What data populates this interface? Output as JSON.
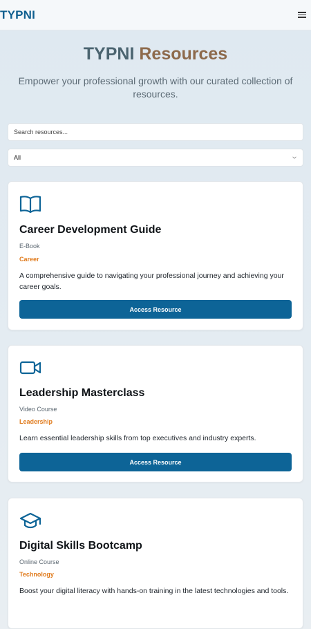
{
  "header": {
    "brand": "TYPNI",
    "menu_icon": "hamburger-menu-icon"
  },
  "hero": {
    "title_part1": "TYPNI",
    "title_part2": "Resources",
    "subtitle": "Empower your professional growth with our curated collection of resources."
  },
  "filters": {
    "search_placeholder": "Search resources...",
    "category_selected": "All"
  },
  "colors": {
    "brand": "#0f5f8f",
    "accent": "#8d6a4c",
    "category": "#e07b1d",
    "button": "#0d6497"
  },
  "resources": [
    {
      "icon": "book-icon",
      "title": "Career Development Guide",
      "type": "E-Book",
      "category": "Career",
      "description": "A comprehensive guide to navigating your professional journey and achieving your career goals.",
      "button_label": "Access Resource"
    },
    {
      "icon": "video-camera-icon",
      "title": "Leadership Masterclass",
      "type": "Video Course",
      "category": "Leadership",
      "description": "Learn essential leadership skills from top executives and industry experts.",
      "button_label": "Access Resource"
    },
    {
      "icon": "graduation-cap-icon",
      "title": "Digital Skills Bootcamp",
      "type": "Online Course",
      "category": "Technology",
      "description": "Boost your digital literacy with hands-on training in the latest technologies and tools."
    }
  ]
}
